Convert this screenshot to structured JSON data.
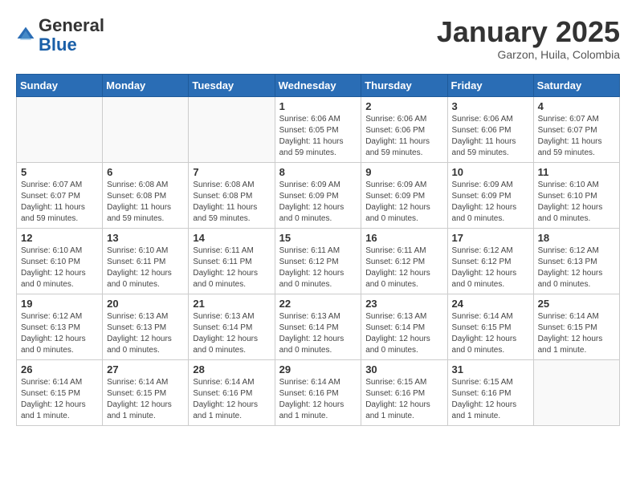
{
  "header": {
    "logo_general": "General",
    "logo_blue": "Blue",
    "month_title": "January 2025",
    "location": "Garzon, Huila, Colombia"
  },
  "days_of_week": [
    "Sunday",
    "Monday",
    "Tuesday",
    "Wednesday",
    "Thursday",
    "Friday",
    "Saturday"
  ],
  "weeks": [
    [
      {
        "day": "",
        "info": ""
      },
      {
        "day": "",
        "info": ""
      },
      {
        "day": "",
        "info": ""
      },
      {
        "day": "1",
        "info": "Sunrise: 6:06 AM\nSunset: 6:05 PM\nDaylight: 11 hours\nand 59 minutes."
      },
      {
        "day": "2",
        "info": "Sunrise: 6:06 AM\nSunset: 6:06 PM\nDaylight: 11 hours\nand 59 minutes."
      },
      {
        "day": "3",
        "info": "Sunrise: 6:06 AM\nSunset: 6:06 PM\nDaylight: 11 hours\nand 59 minutes."
      },
      {
        "day": "4",
        "info": "Sunrise: 6:07 AM\nSunset: 6:07 PM\nDaylight: 11 hours\nand 59 minutes."
      }
    ],
    [
      {
        "day": "5",
        "info": "Sunrise: 6:07 AM\nSunset: 6:07 PM\nDaylight: 11 hours\nand 59 minutes."
      },
      {
        "day": "6",
        "info": "Sunrise: 6:08 AM\nSunset: 6:08 PM\nDaylight: 11 hours\nand 59 minutes."
      },
      {
        "day": "7",
        "info": "Sunrise: 6:08 AM\nSunset: 6:08 PM\nDaylight: 11 hours\nand 59 minutes."
      },
      {
        "day": "8",
        "info": "Sunrise: 6:09 AM\nSunset: 6:09 PM\nDaylight: 12 hours\nand 0 minutes."
      },
      {
        "day": "9",
        "info": "Sunrise: 6:09 AM\nSunset: 6:09 PM\nDaylight: 12 hours\nand 0 minutes."
      },
      {
        "day": "10",
        "info": "Sunrise: 6:09 AM\nSunset: 6:09 PM\nDaylight: 12 hours\nand 0 minutes."
      },
      {
        "day": "11",
        "info": "Sunrise: 6:10 AM\nSunset: 6:10 PM\nDaylight: 12 hours\nand 0 minutes."
      }
    ],
    [
      {
        "day": "12",
        "info": "Sunrise: 6:10 AM\nSunset: 6:10 PM\nDaylight: 12 hours\nand 0 minutes."
      },
      {
        "day": "13",
        "info": "Sunrise: 6:10 AM\nSunset: 6:11 PM\nDaylight: 12 hours\nand 0 minutes."
      },
      {
        "day": "14",
        "info": "Sunrise: 6:11 AM\nSunset: 6:11 PM\nDaylight: 12 hours\nand 0 minutes."
      },
      {
        "day": "15",
        "info": "Sunrise: 6:11 AM\nSunset: 6:12 PM\nDaylight: 12 hours\nand 0 minutes."
      },
      {
        "day": "16",
        "info": "Sunrise: 6:11 AM\nSunset: 6:12 PM\nDaylight: 12 hours\nand 0 minutes."
      },
      {
        "day": "17",
        "info": "Sunrise: 6:12 AM\nSunset: 6:12 PM\nDaylight: 12 hours\nand 0 minutes."
      },
      {
        "day": "18",
        "info": "Sunrise: 6:12 AM\nSunset: 6:13 PM\nDaylight: 12 hours\nand 0 minutes."
      }
    ],
    [
      {
        "day": "19",
        "info": "Sunrise: 6:12 AM\nSunset: 6:13 PM\nDaylight: 12 hours\nand 0 minutes."
      },
      {
        "day": "20",
        "info": "Sunrise: 6:13 AM\nSunset: 6:13 PM\nDaylight: 12 hours\nand 0 minutes."
      },
      {
        "day": "21",
        "info": "Sunrise: 6:13 AM\nSunset: 6:14 PM\nDaylight: 12 hours\nand 0 minutes."
      },
      {
        "day": "22",
        "info": "Sunrise: 6:13 AM\nSunset: 6:14 PM\nDaylight: 12 hours\nand 0 minutes."
      },
      {
        "day": "23",
        "info": "Sunrise: 6:13 AM\nSunset: 6:14 PM\nDaylight: 12 hours\nand 0 minutes."
      },
      {
        "day": "24",
        "info": "Sunrise: 6:14 AM\nSunset: 6:15 PM\nDaylight: 12 hours\nand 0 minutes."
      },
      {
        "day": "25",
        "info": "Sunrise: 6:14 AM\nSunset: 6:15 PM\nDaylight: 12 hours\nand 1 minute."
      }
    ],
    [
      {
        "day": "26",
        "info": "Sunrise: 6:14 AM\nSunset: 6:15 PM\nDaylight: 12 hours\nand 1 minute."
      },
      {
        "day": "27",
        "info": "Sunrise: 6:14 AM\nSunset: 6:15 PM\nDaylight: 12 hours\nand 1 minute."
      },
      {
        "day": "28",
        "info": "Sunrise: 6:14 AM\nSunset: 6:16 PM\nDaylight: 12 hours\nand 1 minute."
      },
      {
        "day": "29",
        "info": "Sunrise: 6:14 AM\nSunset: 6:16 PM\nDaylight: 12 hours\nand 1 minute."
      },
      {
        "day": "30",
        "info": "Sunrise: 6:15 AM\nSunset: 6:16 PM\nDaylight: 12 hours\nand 1 minute."
      },
      {
        "day": "31",
        "info": "Sunrise: 6:15 AM\nSunset: 6:16 PM\nDaylight: 12 hours\nand 1 minute."
      },
      {
        "day": "",
        "info": ""
      }
    ]
  ]
}
